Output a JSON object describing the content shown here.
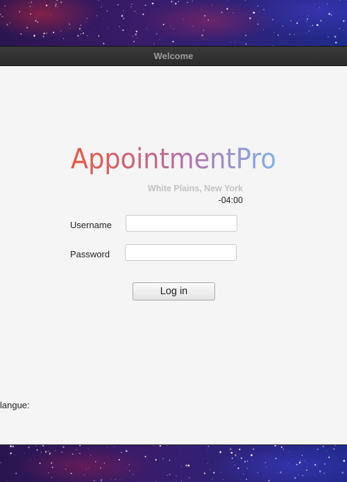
{
  "window": {
    "title": "Welcome"
  },
  "logo": {
    "text": "AppointmentPro",
    "gradient_start": "#e8553f",
    "gradient_mid": "#b76fa6",
    "gradient_end": "#7fb2ea"
  },
  "location": {
    "city": "White Plains, New York",
    "offset": "-04:00"
  },
  "form": {
    "username_label": "Username",
    "username_value": "",
    "password_label": "Password",
    "password_value": "",
    "login_label": "Log in"
  },
  "footer": {
    "language_label": "langue:"
  }
}
